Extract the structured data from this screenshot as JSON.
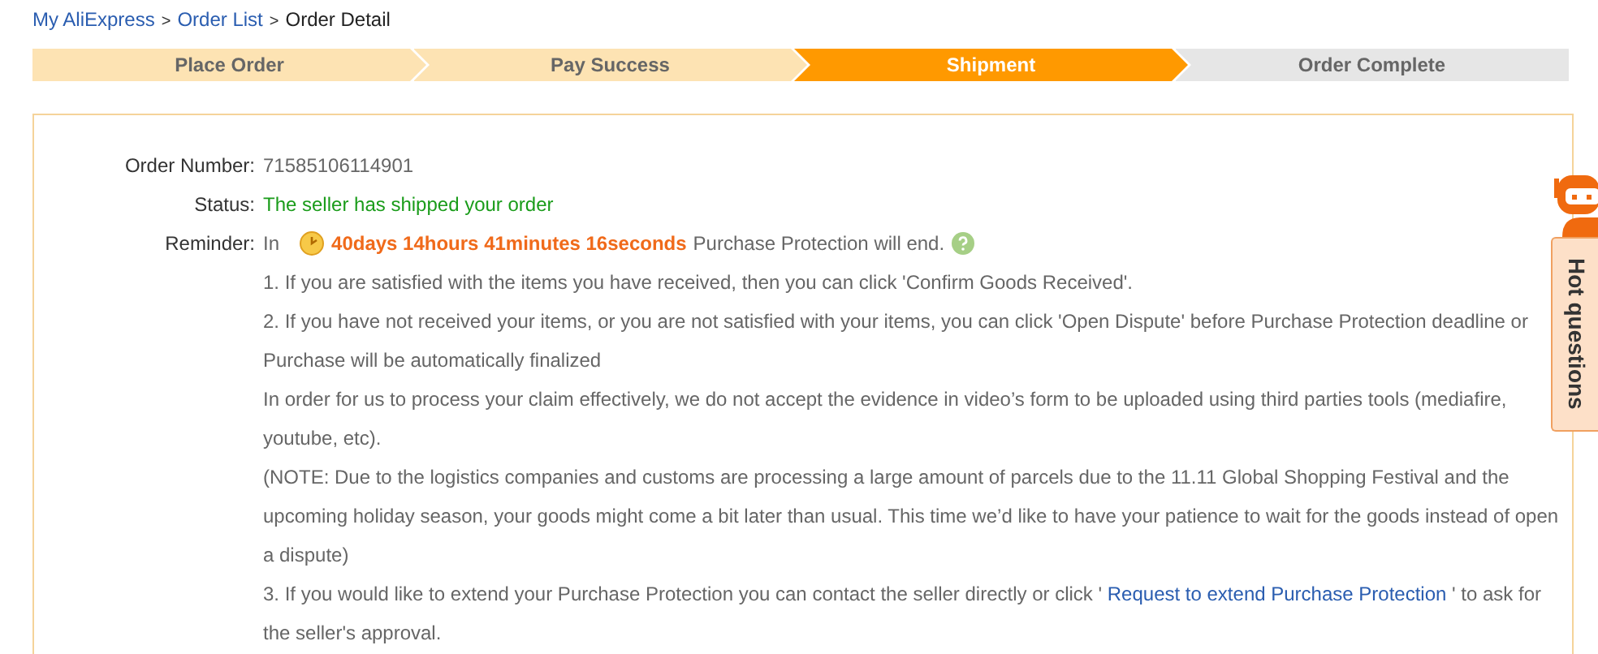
{
  "breadcrumb": [
    {
      "label": "My AliExpress",
      "link": true
    },
    {
      "separator": ">"
    },
    {
      "label": "Order List",
      "link": true
    },
    {
      "separator": ">"
    },
    {
      "label": "Order Detail",
      "link": false
    }
  ],
  "steps": [
    {
      "label": "Place Order",
      "completed": true,
      "selected": false
    },
    {
      "label": "Pay Success",
      "completed": true,
      "selected": false
    },
    {
      "label": "Shipment",
      "completed": false,
      "selected": true
    },
    {
      "label": "Order Complete",
      "completed": false,
      "selected": false
    }
  ],
  "order": {
    "number_label": "Order Number:",
    "number": "71585106114901",
    "status_label": "Status:",
    "status": "The seller has shipped your order",
    "reminder_label": "Reminder:",
    "reminder_prefix": "In",
    "countdown": "40days 14hours 41minutes 16seconds",
    "reminder_suffix": "Purchase Protection will end.",
    "notes": [
      {
        "text": "1. If you are satisfied with the items you have received, then you can click 'Confirm Goods Received'."
      },
      {
        "text": "2. If you have not received your items, or you are not satisfied with your items, you can click 'Open Dispute' before Purchase Protection deadline or Purchase will be automatically finalized"
      },
      {
        "text": "In order for us to process your claim effectively, we do not accept the evidence in video’s form to be uploaded using third parties tools (mediafire, youtube, etc)."
      },
      {
        "text": "(NOTE: Due to the logistics companies and customs are processing a large amount of parcels due to the 11.11 Global Shopping Festival and the upcoming holiday season, your goods might come a bit later than usual. This time we’d like to have your patience to wait for the goods instead of open a dispute)"
      },
      {
        "text": "3. If you would like to extend your Purchase Protection you can contact the seller directly or click ' ",
        "link": "Request to extend Purchase Protection",
        "after": " ' to ask for the seller's approval."
      }
    ]
  },
  "hot_questions": {
    "label": "Hot questions"
  }
}
